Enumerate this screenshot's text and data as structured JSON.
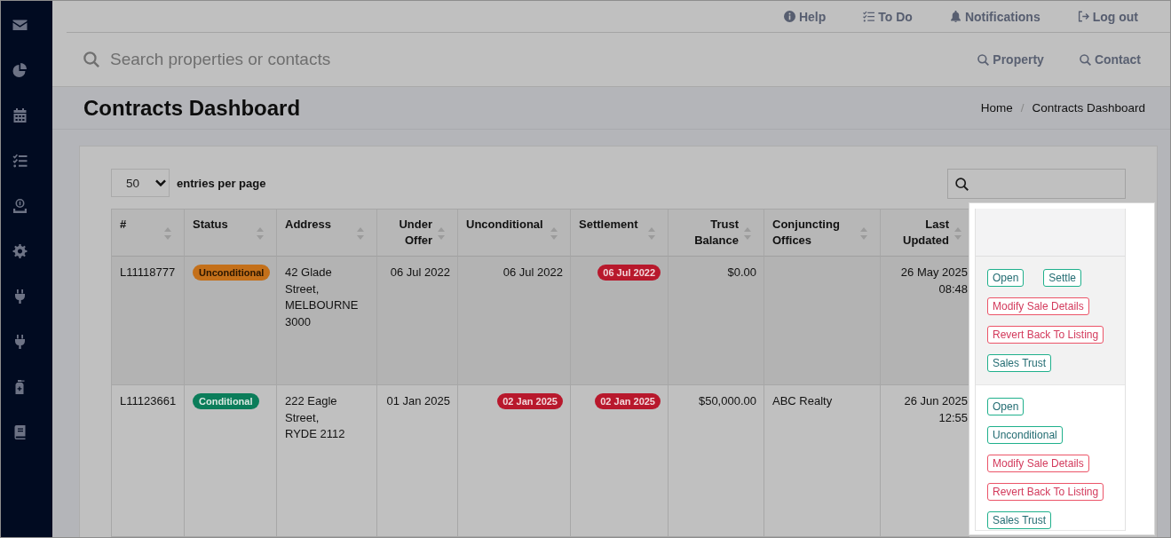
{
  "top_nav": {
    "links": [
      "Help",
      "To Do",
      "Notifications",
      "Log out"
    ]
  },
  "search_bar": {
    "placeholder": "Search properties or contacts",
    "scopes": [
      "Property",
      "Contact"
    ]
  },
  "page_header": {
    "title": "Contracts Dashboard",
    "breadcrumb": {
      "items": [
        "Home",
        "Contracts Dashboard"
      ],
      "separator": "/"
    }
  },
  "table_controls": {
    "page_size": "50",
    "page_size_label": "entries per page"
  },
  "table": {
    "actions_highlighted": true,
    "columns": [
      {
        "label": "#",
        "sortable": true
      },
      {
        "label": "Status",
        "sortable": true
      },
      {
        "label": "Address",
        "sortable": true
      },
      {
        "label": "Under Offer",
        "sortable": true
      },
      {
        "label": "Unconditional",
        "sortable": true
      },
      {
        "label": "Settlement",
        "sortable": true
      },
      {
        "label": "Trust Balance",
        "sortable": true
      },
      {
        "label": "Conjuncting Offices",
        "sortable": true
      },
      {
        "label": "Last Updated",
        "sortable": true
      }
    ],
    "rows": [
      {
        "id": "L11118777",
        "status": {
          "label": "Unconditional",
          "color": "#c4701a"
        },
        "address": "42 Glade Street,\nMELBOURNE 3000",
        "under_offer": {
          "date": "06 Jul 2022",
          "flagged": false
        },
        "unconditional": {
          "date": "06 Jul 2022",
          "flagged": false
        },
        "settlement": {
          "date": "06 Jul 2022",
          "flagged": true
        },
        "trust_balance": "$0.00",
        "last_updated": "26 May 2025 08:48",
        "actions": [
          {
            "label": "Open",
            "kind": "success"
          },
          {
            "label": "Settle",
            "kind": "success"
          },
          {
            "label": "Modify Sale Details",
            "kind": "danger"
          },
          {
            "label": "Revert Back To Listing",
            "kind": "danger"
          },
          {
            "label": "Sales Trust",
            "kind": "success"
          }
        ]
      },
      {
        "id": "L11123661",
        "status": {
          "label": "Conditional",
          "color": "#0b7d5a"
        },
        "address": "222 Eagle Street,\nRYDE 2112",
        "under_offer": {
          "date": "01 Jan 2025",
          "flagged": false
        },
        "unconditional": {
          "date": "02 Jan 2025",
          "flagged": true
        },
        "settlement": {
          "date": "02 Jan 2025",
          "flagged": true
        },
        "trust_balance": "$50,000.00",
        "conjuncting_offices": "ABC Realty",
        "last_updated": "26 Jun 2025 12:55",
        "actions": [
          {
            "label": "Open",
            "kind": "success"
          },
          {
            "label": "Unconditional",
            "kind": "success"
          },
          {
            "label": "Modify Sale Details",
            "kind": "danger"
          },
          {
            "label": "Revert Back To Listing",
            "kind": "danger"
          },
          {
            "label": "Sales Trust",
            "kind": "success"
          }
        ]
      }
    ]
  }
}
